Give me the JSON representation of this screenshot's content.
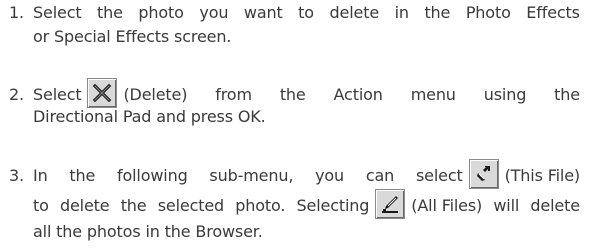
{
  "steps": [
    {
      "number": "1.",
      "line1": [
        "Select",
        "the",
        "photo",
        "you",
        "want",
        "to",
        "delete",
        "in",
        "the",
        "Photo",
        "Effects"
      ],
      "line2": "or Special Effects screen."
    },
    {
      "number": "2.",
      "w_select": "Select",
      "w_delete": "(Delete)",
      "line1_rest": [
        "from",
        "the",
        "Action",
        "menu",
        "using",
        "the"
      ],
      "line2": "Directional Pad and press OK."
    },
    {
      "number": "3.",
      "line1": [
        "In",
        "the",
        "following",
        "sub-menu,",
        "you",
        "can",
        "select"
      ],
      "this_file": "(This File)",
      "line2_a": [
        "to",
        "delete",
        "the",
        "selected",
        "photo.",
        "Selecting"
      ],
      "all_files": "(All Files)",
      "line2_b": [
        "will",
        "delete"
      ],
      "line3": "all the photos in the Browser."
    }
  ],
  "icons": {
    "delete": "delete-x-icon",
    "this_file": "this-file-icon",
    "all_files": "all-files-icon"
  }
}
